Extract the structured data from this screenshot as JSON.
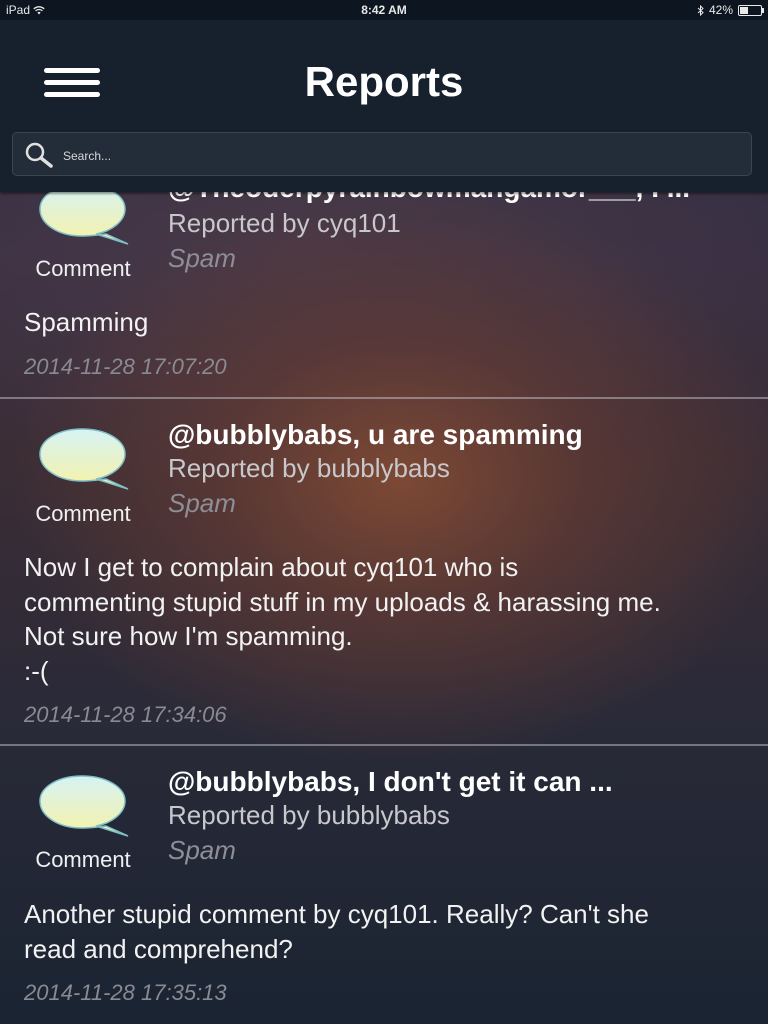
{
  "statusbar": {
    "device": "iPad",
    "time": "8:42 AM",
    "battery": "42%"
  },
  "navbar": {
    "title": "Reports"
  },
  "search": {
    "placeholder": "Search..."
  },
  "reports": [
    {
      "title": "@Theoderpyrainbowmangamor___, I ...",
      "reporter": "Reported by cyq101",
      "category": "Spam",
      "type": "Comment",
      "body": "Spamming",
      "timestamp": "2014-11-28 17:07:20"
    },
    {
      "title": "@bubblybabs, u are spamming",
      "reporter": "Reported by bubblybabs",
      "category": "Spam",
      "type": "Comment",
      "body": "Now I get to complain about cyq101 who is\ncommenting stupid stuff in my uploads & harassing me.\nNot sure how I'm spamming.\n:-(",
      "timestamp": "2014-11-28 17:34:06"
    },
    {
      "title": "@bubblybabs, I don't get it can ...",
      "reporter": "Reported by bubblybabs",
      "category": "Spam",
      "type": "Comment",
      "body": "Another stupid comment by cyq101.  Really?  Can't she\nread and comprehend?",
      "timestamp": "2014-11-28 17:35:13"
    }
  ]
}
